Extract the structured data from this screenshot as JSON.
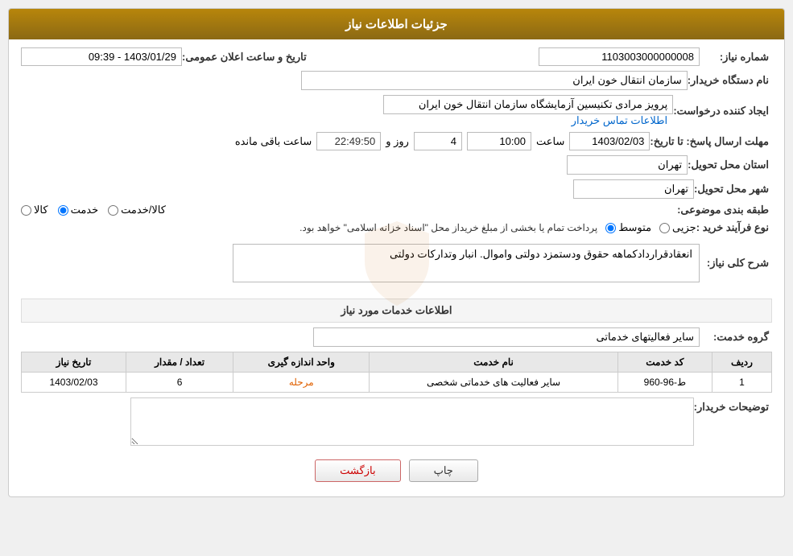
{
  "header": {
    "title": "جزئیات اطلاعات نیاز"
  },
  "fields": {
    "shomara_niaz_label": "شماره نیاز:",
    "shomara_niaz_value": "1103003000000008",
    "name_dastgah_label": "نام دستگاه خریدار:",
    "name_dastgah_value": "سازمان انتقال خون ایران",
    "ijad_konande_label": "ایجاد کننده درخواست:",
    "ijad_konande_value": "پرویز مرادی تکنیسین آزمایشگاه سازمان انتقال خون ایران",
    "etelaat_link": "اطلاعات تماس خریدار",
    "mohlat_ersal_label": "مهلت ارسال پاسخ: تا تاریخ:",
    "mohlat_date": "1403/02/03",
    "mohlat_saat_label": "ساعت",
    "mohlat_saat_value": "10:00",
    "mohlat_rooz_label": "روز و",
    "mohlat_rooz_value": "4",
    "mohlat_countdown": "22:49:50",
    "mohlat_baqi": "ساعت باقی مانده",
    "tarikh_elan_label": "تاریخ و ساعت اعلان عمومی:",
    "tarikh_elan_value": "1403/01/29 - 09:39",
    "ostan_label": "استان محل تحویل:",
    "ostan_value": "تهران",
    "shahr_label": "شهر محل تحویل:",
    "shahr_value": "تهران",
    "tabaqe_label": "طبقه بندی موضوعی:",
    "tabaqe_options": [
      "کالا",
      "خدمت",
      "کالا/خدمت"
    ],
    "tabaqe_selected": "خدمت",
    "noe_farayand_label": "نوع فرآیند خرید :",
    "noe_farayand_options": [
      "جزیی",
      "متوسط"
    ],
    "noe_farayand_selected": "متوسط",
    "noe_farayand_note": "پرداخت تمام یا بخشی از مبلغ خریداز محل \"اسناد خزانه اسلامی\" خواهد بود.",
    "sharh_label": "شرح کلی نیاز:",
    "sharh_value": "انعقادقراردادکماهه حقوق ودستمزد دولتی واموال. انبار وتدارکات دولتی",
    "services_section": "اطلاعات خدمات مورد نیاز",
    "group_label": "گروه خدمت:",
    "group_value": "سایر فعالیتهای خدماتی",
    "table_headers": [
      "ردیف",
      "کد خدمت",
      "نام خدمت",
      "واحد اندازه گیری",
      "تعداد / مقدار",
      "تاریخ نیاز"
    ],
    "table_rows": [
      {
        "radif": "1",
        "kod": "ط-96-960",
        "name": "سایر فعالیت های خدماتی شخصی",
        "vahed": "مرحله",
        "tedad": "6",
        "tarikh": "1403/02/03"
      }
    ],
    "toozihat_label": "توضیحات خریدار:",
    "toozihat_value": "",
    "btn_print": "چاپ",
    "btn_back": "بازگشت"
  }
}
